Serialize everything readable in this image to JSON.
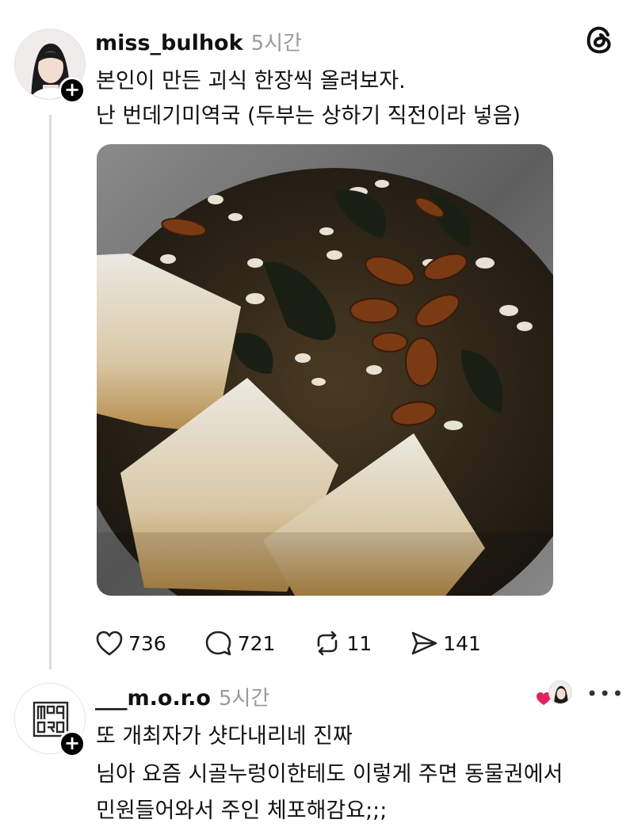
{
  "post": {
    "username": "miss_bulhok",
    "time": "5시간",
    "text_line1": "본인이 만든 괴식 한장씩 올려보자.",
    "text_line2": "난 번데기미역국 (두부는 상하기 직전이라 넣음)",
    "image_alt": "번데기미역국",
    "stats": {
      "likes": "736",
      "comments": "721",
      "reposts": "11",
      "shares": "141"
    }
  },
  "reply": {
    "username": "___m.o.r.o",
    "time": "5시간",
    "text_line1": "또 개최자가 샷다내리네 진짜",
    "text_line2": "님아 요즘 시골누렁이한테도 이렇게 주면 동물권에서",
    "text_line3": "민원들어와서 주인 체포해감요;;;",
    "avatar_text": "MORO"
  },
  "icons": {
    "app_logo": "threads-logo-icon",
    "like": "heart-icon",
    "comment": "comment-bubble-icon",
    "repost": "repost-icon",
    "share": "send-icon",
    "follow": "plus-icon",
    "more": "more-icon"
  },
  "colors": {
    "text": "#111111",
    "muted": "#9a9a9a",
    "thread_line": "#dcdcdc",
    "liked_heart": "#e0245e"
  }
}
